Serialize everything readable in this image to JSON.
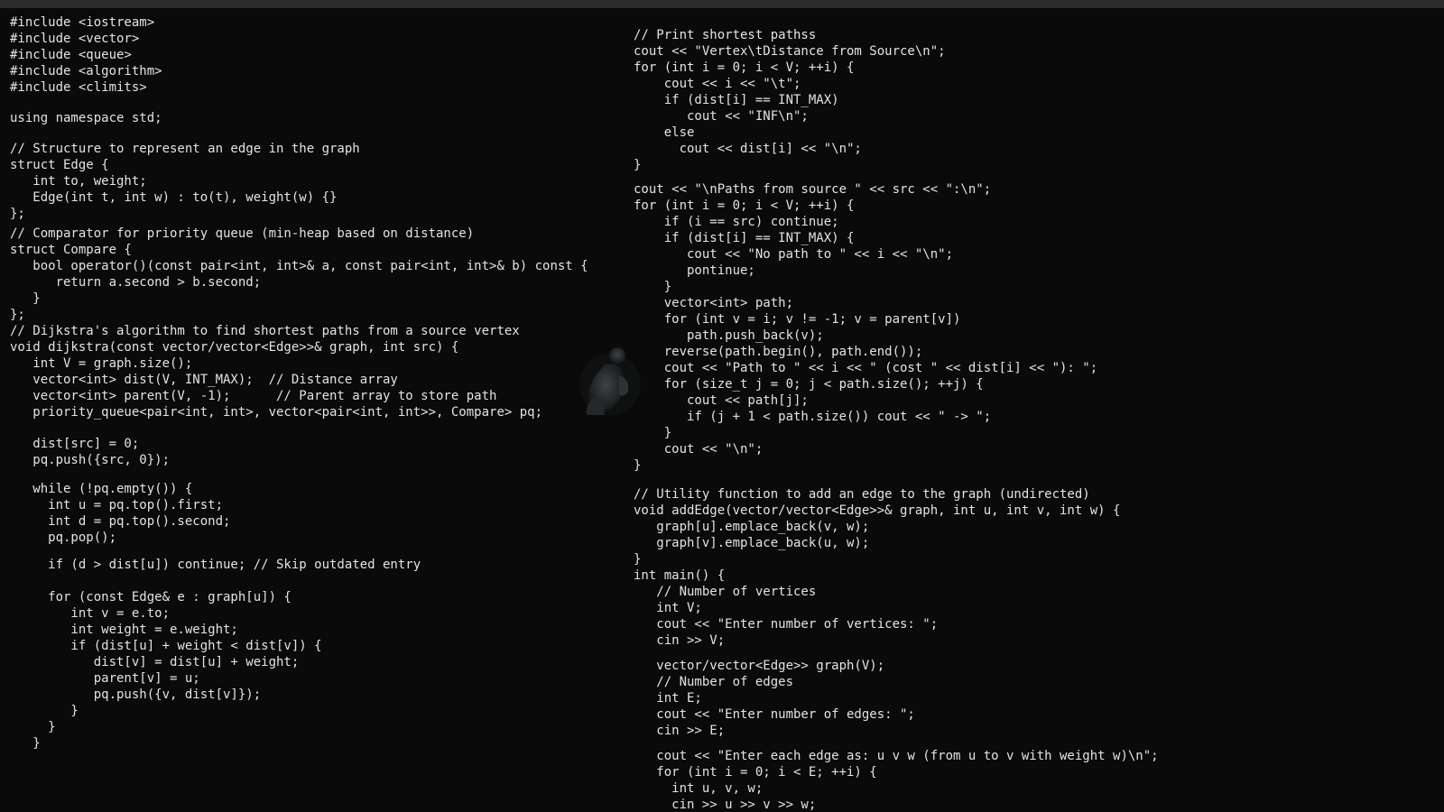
{
  "left_code": {
    "lines": [
      "#include <iostream>",
      "#include <vector>",
      "#include <queue>",
      "#include <algorithm>",
      "#include <climits>",
      "using namespace std;",
      "// Structure to represent an edge in the graph",
      "struct Edge {",
      "   int to, weight;",
      "   Edge(int t, int w) : to(t), weight(w) {}",
      "};",
      "// Comparator for priority queue (min-heap based on distance)",
      "struct Compare {",
      "   bool operator()(const pair<int, int>& a, const pair<int, int>& b) const {",
      "      return a.second > b.second;",
      "   }",
      "};",
      "// Dijkstra's algorithm to find shortest paths from a source vertex",
      "void dijkstra(const vector/vector<Edge>>& graph, int src) {",
      "   int V = graph.size();",
      "   vector<int> dist(V, INT_MAX);  // Distance array",
      "   vector<int> parent(V, -1);      // Parent array to store path",
      "   priority_queue<pair<int, int>, vector<pair<int, int>>, Compare> pq;",
      "   dist[src] = 0;",
      "   pq.push({src, 0});",
      "   while (!pq.empty()) {",
      "     int u = pq.top().first;",
      "     int d = pq.top().second;",
      "     pq.pop();",
      "     if (d > dist[u]) continue; // Skip outdated entry",
      "     for (const Edge& e : graph[u]) {",
      "        int v = e.to;",
      "        int weight = e.weight;",
      "        if (dist[u] + weight < dist[v]) {",
      "           dist[v] = dist[u] + weight;",
      "           parent[v] = u;",
      "           pq.push({v, dist[v]});",
      "        }",
      "     }",
      "   }"
    ]
  },
  "right_code": {
    "lines": [
      "// Print shortest pathss",
      "cout << \"Vertex\\tDistance from Source\\n\";",
      "for (int i = 0; i < V; ++i) {",
      "    cout << i << \"\\t\";",
      "    if (dist[i] == INT_MAX)",
      "       cout << \"INF\\n\";",
      "    else",
      "      cout << dist[i] << \"\\n\";",
      "}",
      "cout << \"\\nPaths from source \" << src << \":\\n\";",
      "for (int i = 0; i < V; ++i) {",
      "    if (i == src) continue;",
      "    if (dist[i] == INT_MAX) {",
      "       cout << \"No path to \" << i << \"\\n\";",
      "       pontinue;",
      "    }",
      "    vector<int> path;",
      "    for (int v = i; v != -1; v = parent[v])",
      "       path.push_back(v);",
      "    reverse(path.begin(), path.end());",
      "    cout << \"Path to \" << i << \" (cost \" << dist[i] << \"): \";",
      "    for (size_t j = 0; j < path.size(); ++j) {",
      "       cout << path[j];",
      "       if (j + 1 < path.size()) cout << \" -> \";",
      "    }",
      "    cout << \"\\n\";",
      "}",
      "// Utility function to add an edge to the graph (undirected)",
      "void addEdge(vector/vector<Edge>>& graph, int u, int v, int w) {",
      "   graph[u].emplace_back(v, w);",
      "   graph[v].emplace_back(u, w);",
      "}",
      "int main() {",
      "   // Number of vertices",
      "   int V;",
      "   cout << \"Enter number of vertices: \";",
      "   cin >> V;",
      "   vector/vector<Edge>> graph(V);",
      "   // Number of edges",
      "   int E;",
      "   cout << \"Enter number of edges: \";",
      "   cin >> E;",
      "   cout << \"Enter each edge as: u v w (from u to v with weight w)\\n\";",
      "   for (int i = 0; i < E; ++i) {",
      "     int u, v, w;",
      "     cin >> u >> v >> w;"
    ]
  }
}
